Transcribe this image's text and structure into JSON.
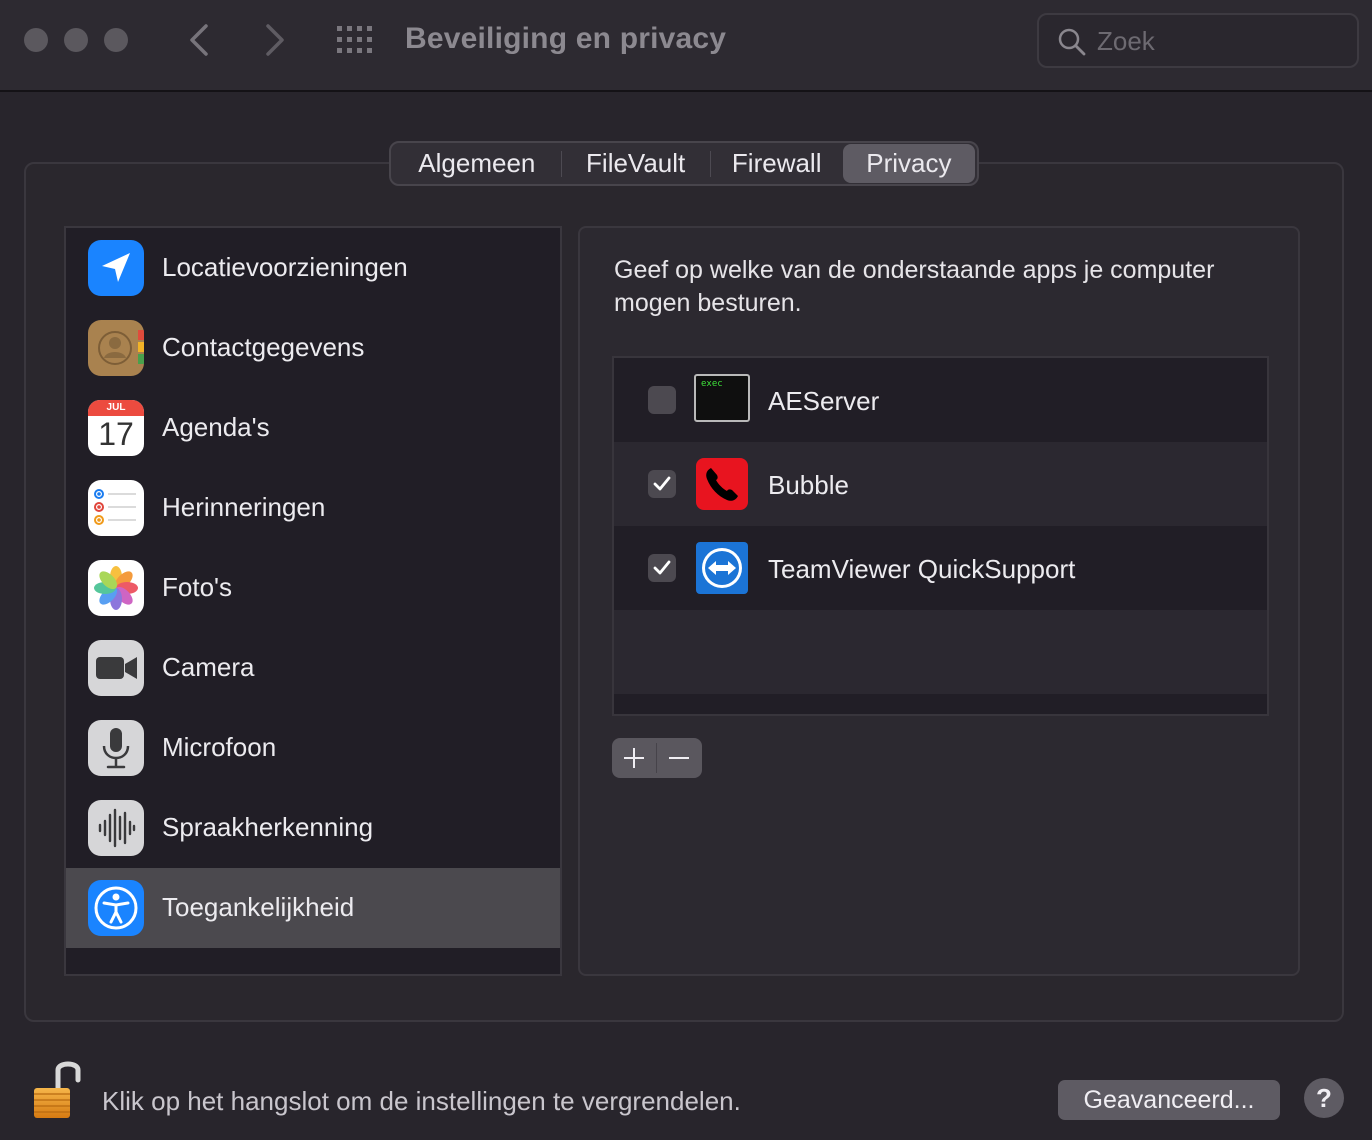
{
  "window": {
    "title": "Beveiliging en privacy",
    "search_placeholder": "Zoek"
  },
  "tabs": [
    {
      "label": "Algemeen",
      "selected": false
    },
    {
      "label": "FileVault",
      "selected": false
    },
    {
      "label": "Firewall",
      "selected": false
    },
    {
      "label": "Privacy",
      "selected": true
    }
  ],
  "sidebar": {
    "items": [
      {
        "label": "Locatievoorzieningen",
        "icon": "location-arrow-icon"
      },
      {
        "label": "Contactgegevens",
        "icon": "contacts-icon"
      },
      {
        "label": "Agenda's",
        "icon": "calendar-icon",
        "calendar_month": "JUL",
        "calendar_day": "17"
      },
      {
        "label": "Herinneringen",
        "icon": "reminders-icon"
      },
      {
        "label": "Foto's",
        "icon": "photos-icon"
      },
      {
        "label": "Camera",
        "icon": "camera-icon"
      },
      {
        "label": "Microfoon",
        "icon": "microphone-icon"
      },
      {
        "label": "Spraakherkenning",
        "icon": "waveform-icon"
      },
      {
        "label": "Toegankelijkheid",
        "icon": "accessibility-icon",
        "selected": true
      }
    ]
  },
  "panel": {
    "description": "Geef op welke van de onderstaande apps je computer mogen besturen.",
    "apps": [
      {
        "name": "AEServer",
        "checked": false,
        "icon": "terminal-exec-icon",
        "icon_text": "exec"
      },
      {
        "name": "Bubble",
        "checked": true,
        "icon": "phone-handset-icon"
      },
      {
        "name": "TeamViewer QuickSupport",
        "checked": true,
        "icon": "teamviewer-icon"
      }
    ]
  },
  "footer": {
    "lock_text": "Klik op het hangslot om de instellingen te vergrendelen.",
    "advanced_label": "Geavanceerd...",
    "help_label": "?"
  },
  "colors": {
    "selected_blue": "#1a84ff",
    "bubble_red": "#e8141f",
    "teamviewer_blue": "#1b74d6"
  }
}
